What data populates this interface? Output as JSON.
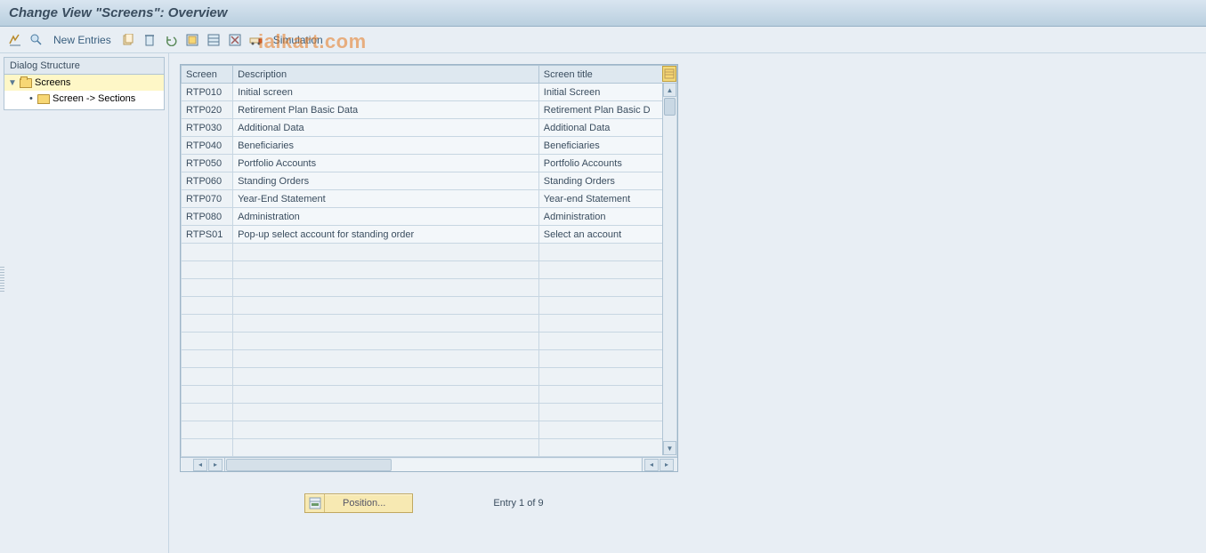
{
  "title": "Change View \"Screens\": Overview",
  "watermark": "ialkart.com",
  "toolbar": {
    "new_entries": "New Entries",
    "simulation": "Simulation"
  },
  "sidebar": {
    "header": "Dialog Structure",
    "items": [
      {
        "label": "Screens",
        "selected": true,
        "level": 0
      },
      {
        "label": "Screen -> Sections",
        "selected": false,
        "level": 1
      }
    ]
  },
  "table": {
    "columns": {
      "screen": "Screen",
      "description": "Description",
      "title": "Screen title"
    },
    "rows": [
      {
        "screen": "RTP010",
        "description": "Initial screen",
        "title": "Initial Screen"
      },
      {
        "screen": "RTP020",
        "description": "Retirement Plan Basic Data",
        "title": "Retirement Plan Basic D"
      },
      {
        "screen": "RTP030",
        "description": "Additional Data",
        "title": "Additional Data"
      },
      {
        "screen": "RTP040",
        "description": "Beneficiaries",
        "title": "Beneficiaries"
      },
      {
        "screen": "RTP050",
        "description": "Portfolio Accounts",
        "title": "Portfolio Accounts"
      },
      {
        "screen": "RTP060",
        "description": "Standing Orders",
        "title": "Standing Orders"
      },
      {
        "screen": "RTP070",
        "description": "Year-End Statement",
        "title": "Year-end Statement"
      },
      {
        "screen": "RTP080",
        "description": "Administration",
        "title": "Administration"
      },
      {
        "screen": "RTPS01",
        "description": "Pop-up select account for standing order",
        "title": "Select an account"
      }
    ],
    "empty_rows": 12
  },
  "footer": {
    "position_label": "Position...",
    "entry_text": "Entry 1 of 9"
  }
}
